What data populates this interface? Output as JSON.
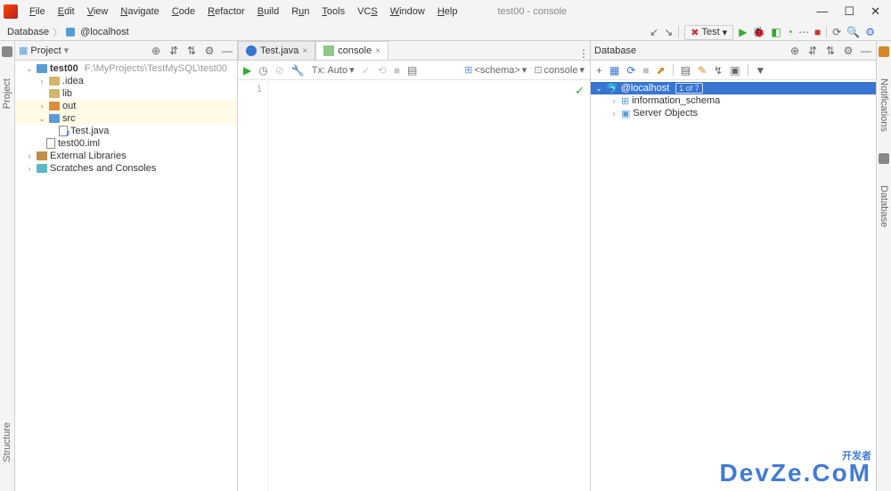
{
  "title": "test00 - console",
  "menus": [
    "File",
    "Edit",
    "View",
    "Navigate",
    "Code",
    "Refactor",
    "Build",
    "Run",
    "Tools",
    "VCS",
    "Window",
    "Help"
  ],
  "breadcrumb": {
    "a": "Database",
    "b": "@localhost"
  },
  "project_panel": {
    "title": "Project"
  },
  "project_tree": {
    "root_name": "test00",
    "root_path": "F:\\MyProjects\\TestMySQL\\test00",
    "idea": ".idea",
    "lib": "lib",
    "out": "out",
    "src": "src",
    "test_java": "Test.java",
    "iml": "test00.iml",
    "ext_lib": "External Libraries",
    "scratches": "Scratches and Consoles"
  },
  "tabs": {
    "test": "Test.java",
    "console": "console"
  },
  "editor_toolbar": {
    "tx": "Tx: Auto",
    "schema": "<schema>",
    "console": "console"
  },
  "editor": {
    "line": "1"
  },
  "database_panel": {
    "title": "Database"
  },
  "db_tree": {
    "host": "@localhost",
    "badge": "1 of 7",
    "info_schema": "information_schema",
    "server_obj": "Server Objects"
  },
  "run_config": "Test",
  "right_tabs": {
    "notif": "Notifications",
    "db": "Database"
  },
  "left_tabs": {
    "proj": "Project",
    "struct": "Structure"
  },
  "watermark": {
    "l1": "开发者",
    "l2": "DevZe.CoM"
  }
}
